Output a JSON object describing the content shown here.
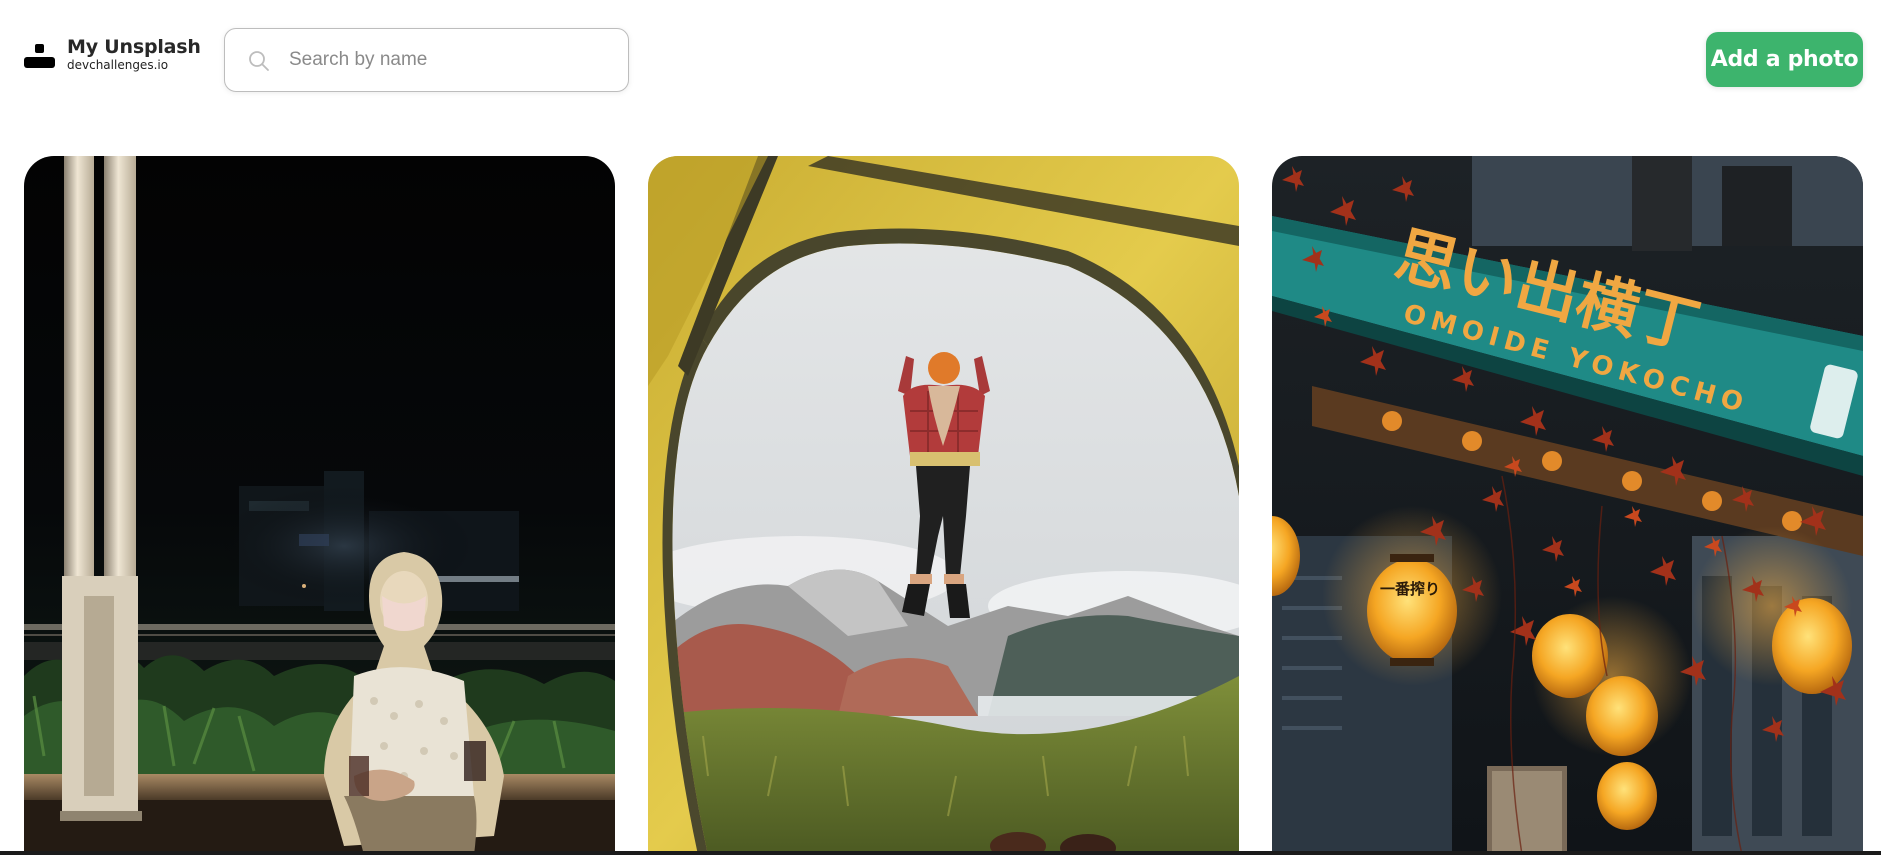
{
  "brand": {
    "title": "My Unsplash",
    "subtitle": "devchallenges.io",
    "icon": "unsplash-user-icon"
  },
  "search": {
    "placeholder": "Search by name",
    "value": "",
    "icon": "search-icon"
  },
  "actions": {
    "add_photo_label": "Add a photo"
  },
  "colors": {
    "accent": "#3DB46D",
    "background": "#FFFFFF",
    "text": "#333333",
    "border": "#BDBDBD"
  },
  "gallery": {
    "photos": [
      {
        "label": ""
      },
      {
        "label": ""
      },
      {
        "label": ""
      }
    ]
  },
  "photo_3": {
    "sign_text": "OMOIDE YOKOCHO",
    "sign_kanji": "思い出横丁",
    "lantern_text": "一番搾り"
  }
}
